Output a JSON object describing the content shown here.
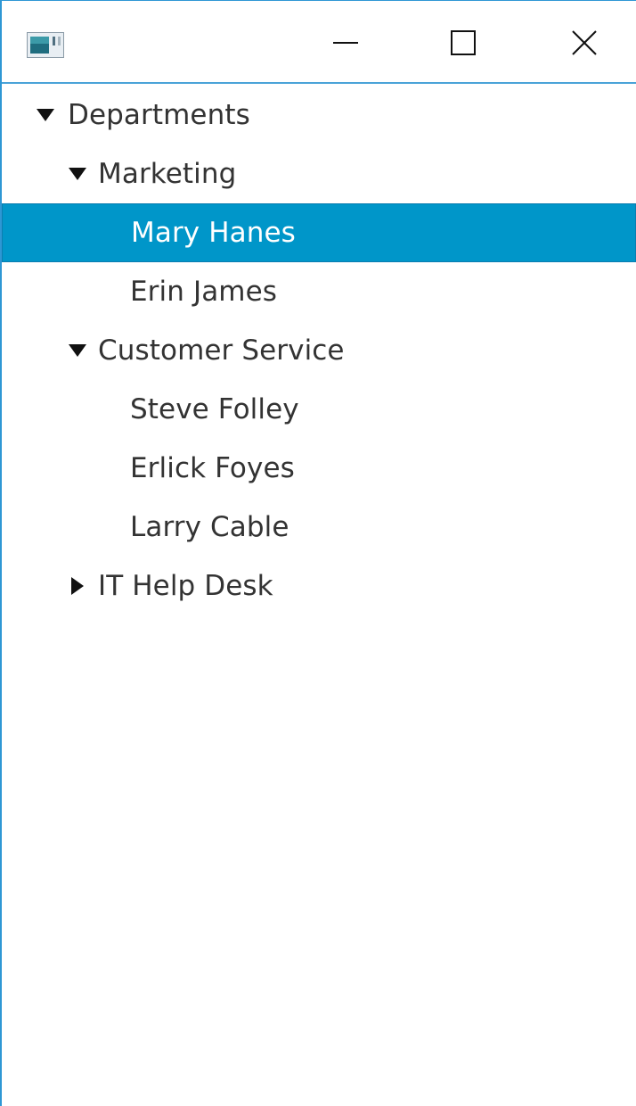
{
  "window": {
    "controls": {
      "minimize": "minimize",
      "maximize": "maximize",
      "close": "close"
    }
  },
  "tree": {
    "selected": "Mary Hanes",
    "items": [
      {
        "label": "Departments",
        "level": 0,
        "expander": "expanded"
      },
      {
        "label": "Marketing",
        "level": 1,
        "expander": "expanded"
      },
      {
        "label": "Mary Hanes",
        "level": 2,
        "expander": "none",
        "selected": true
      },
      {
        "label": "Erin James",
        "level": 2,
        "expander": "none"
      },
      {
        "label": "Customer Service",
        "level": 1,
        "expander": "expanded"
      },
      {
        "label": "Steve Folley",
        "level": 2,
        "expander": "none"
      },
      {
        "label": "Erlick Foyes",
        "level": 2,
        "expander": "none"
      },
      {
        "label": "Larry Cable",
        "level": 2,
        "expander": "none"
      },
      {
        "label": "IT Help Desk",
        "level": 1,
        "expander": "collapsed"
      }
    ]
  },
  "colors": {
    "selection": "#0096c9",
    "accent_border": "#2e97d4",
    "text": "#333333",
    "selected_text": "#ffffff"
  }
}
